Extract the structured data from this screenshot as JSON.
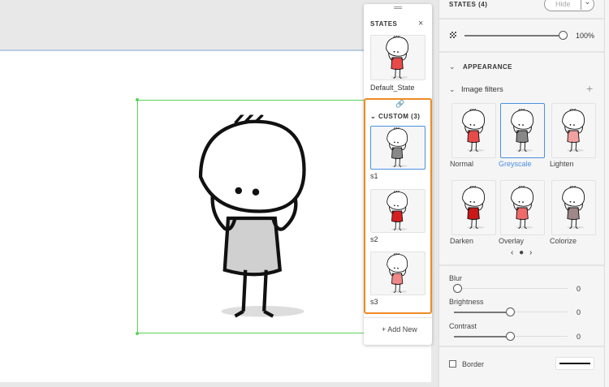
{
  "states_panel": {
    "title": "STATES",
    "close_icon": "close-icon",
    "default_state": "Default_State",
    "custom_header": "CUSTOM (3)",
    "custom_states": [
      "s1",
      "s2",
      "s3"
    ],
    "add_new": "+ Add New"
  },
  "right_panel": {
    "states_header": "STATES (4)",
    "hide_button": "Hide",
    "opacity_value": "100%",
    "opacity_fraction": 1.0,
    "appearance": "APPEARANCE",
    "image_filters": "Image filters",
    "filters": [
      {
        "name": "Normal",
        "shirt": "#e84a4a"
      },
      {
        "name": "Greyscale",
        "shirt": "#888888",
        "selected": true
      },
      {
        "name": "Lighten",
        "shirt": "#f2a0a0"
      },
      {
        "name": "Darken",
        "shirt": "#c81818"
      },
      {
        "name": "Overlay",
        "shirt": "#f06a6a"
      },
      {
        "name": "Colorize",
        "shirt": "#a08888"
      }
    ],
    "blur": {
      "label": "Blur",
      "value": "0"
    },
    "brightness": {
      "label": "Brightness",
      "value": "0"
    },
    "contrast": {
      "label": "Contrast",
      "value": "0"
    },
    "border": {
      "label": "Border"
    }
  },
  "colors": {
    "accent": "#4a90e2",
    "custom_outline": "#f08a24",
    "selection": "#5ad25a"
  }
}
